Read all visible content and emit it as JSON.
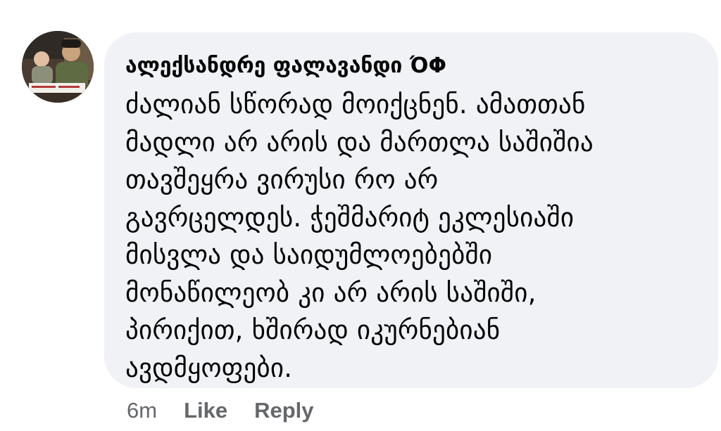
{
  "comment": {
    "author": "ალექსანდრე ფალავანდი ΌΦ",
    "text_lines": [
      "ძალიან სწორად მოიქცნენ. ამათთან",
      "მადლი არ არის და მართლა საშიშია",
      "თავშეყრა ვირუსი რო არ",
      "გავრცელდეს. ჭეშმარიტ ეკლესიაში",
      "მისვლა და საიდუმლოებებში",
      "მონაწილეობ კი არ არის საშიში,",
      "პირიქით, ხშირად იკურნებიან",
      "ავდმყოფები."
    ],
    "timestamp": "6m",
    "like_label": "Like",
    "reply_label": "Reply"
  },
  "colors": {
    "bubble_background": "#f0f2f5",
    "text": "#050505",
    "secondary_text": "#65676b"
  }
}
